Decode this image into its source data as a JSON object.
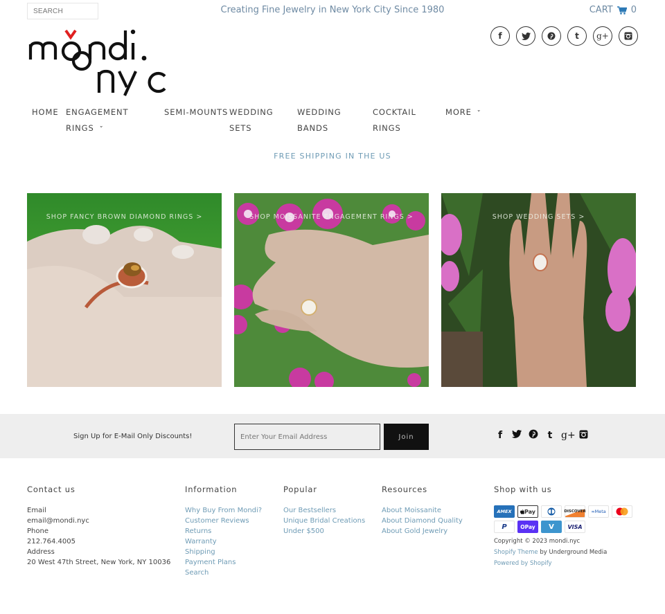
{
  "header": {
    "search_placeholder": "SEARCH",
    "tagline": "Creating Fine Jewelry in New York City Since 1980",
    "cart_label": "CART",
    "cart_count": "0",
    "logo_line1": "mondi.",
    "logo_line2": "nyc",
    "social_icons": [
      "facebook-icon",
      "twitter-icon",
      "pinterest-icon",
      "tumblr-icon",
      "google-plus-icon",
      "instagram-icon"
    ]
  },
  "nav": {
    "items": [
      {
        "line1": "HOME",
        "line2": ""
      },
      {
        "line1": "ENGAGEMENT",
        "line2": "RINGS",
        "dropdown": true
      },
      {
        "line1": "SEMI-MOUNTS",
        "line2": ""
      },
      {
        "line1": "WEDDING",
        "line2": "SETS"
      },
      {
        "line1": "WEDDING",
        "line2": "BANDS"
      },
      {
        "line1": "COCKTAIL",
        "line2": "RINGS"
      },
      {
        "line1": "MORE",
        "line2": "",
        "dropdown": true
      }
    ],
    "chevron": "˅"
  },
  "banner": {
    "shipping": "FREE SHIPPING IN THE US"
  },
  "tiles": [
    {
      "caption": "SHOP FANCY BROWN DIAMOND RINGS >"
    },
    {
      "caption": "SHOP MOISSANITE ENGAGEMENT RINGS >"
    },
    {
      "caption": "SHOP WEDDING SETS >"
    }
  ],
  "signup": {
    "text": "Sign Up for E-Mail Only Discounts!",
    "placeholder": "Enter Your Email Address",
    "button": "Join"
  },
  "footer": {
    "contact": {
      "title": "Contact us",
      "lines": [
        "Email",
        "email@mondi.nyc",
        "Phone",
        "212.764.4005",
        "Address",
        "20 West 47th Street, New York, NY 10036"
      ]
    },
    "information": {
      "title": "Information",
      "links": [
        "Why Buy From Mondi?",
        "Customer Reviews",
        "Returns",
        "Warranty",
        "Shipping",
        "Payment Plans",
        "Search"
      ]
    },
    "popular": {
      "title": "Popular",
      "links": [
        "Our Bestsellers",
        "Unique Bridal Creations",
        "Under $500"
      ]
    },
    "resources": {
      "title": "Resources",
      "links": [
        "About Moissanite",
        "About Diamond Quality",
        "About Gold Jewelry"
      ]
    },
    "shop": {
      "title": "Shop with us",
      "payments_row1": [
        "AMEX",
        " Pay",
        "",
        "DISCOVER",
        "∞Meta",
        ""
      ],
      "payments_row2": [
        "P",
        "OPay",
        "V",
        "VISA"
      ],
      "copyright": "Copyright © 2023 mondi.nyc",
      "theme_link": "Shopify Theme",
      "theme_by": " by Underground Media",
      "powered": "Powered by Shopify"
    }
  },
  "colors": {
    "link": "#6e9bb5",
    "tagline": "#6e8aa3",
    "cart_icon": "#2a78b5",
    "logo_accent": "#e02020",
    "band": "#eeeeee",
    "button": "#111111"
  }
}
